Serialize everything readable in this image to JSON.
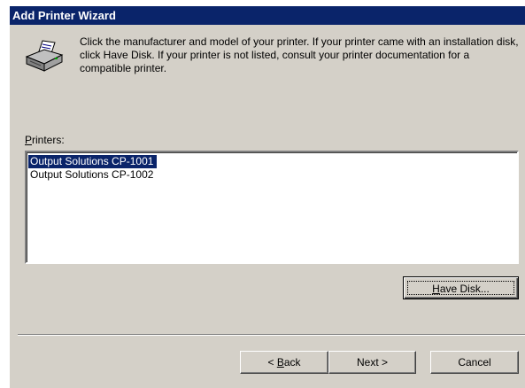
{
  "window": {
    "title": "Add Printer Wizard"
  },
  "header": {
    "icon": "printer-icon",
    "description": "Click the manufacturer and model of your printer. If your printer came with an installation disk, click Have Disk. If your printer is not listed, consult your printer documentation for a compatible printer."
  },
  "printers": {
    "label_accel": "P",
    "label_rest": "rinters:",
    "items": [
      "Output Solutions CP-1001",
      "Output Solutions CP-1002"
    ],
    "selected_index": 0
  },
  "buttons": {
    "have_disk_accel": "H",
    "have_disk_rest": "ave Disk...",
    "back_prefix": "< ",
    "back_accel": "B",
    "back_rest": "ack",
    "next": "Next >",
    "cancel": "Cancel"
  },
  "colors": {
    "titlebar": "#0a246a",
    "face": "#d4d0c8",
    "selection": "#0a246a"
  }
}
